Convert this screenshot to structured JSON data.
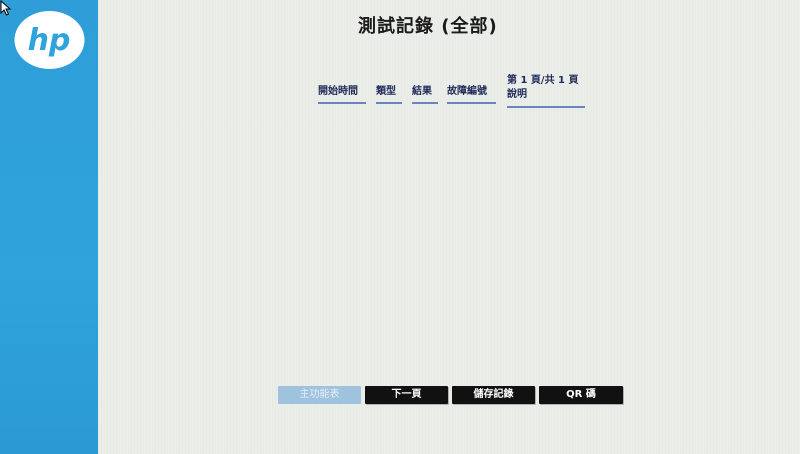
{
  "header": {
    "title": "測試記錄 (全部)"
  },
  "table": {
    "columns": [
      "開始時間",
      "類型",
      "結果",
      "故障編號"
    ],
    "page_info_line1": "第 1 頁/共 1 頁",
    "page_info_line2": "說明"
  },
  "footer": {
    "main_menu_label": "主功能表",
    "next_page_label": "下一頁",
    "save_log_label": "儲存記錄",
    "qr_label": "QR 碼"
  },
  "colors": {
    "sidebar": "#2fa3dc",
    "background": "#ebeee8",
    "button": "#111111",
    "button_disabled": "#9fc2df",
    "underline": "#6c86bd"
  },
  "icons": {
    "logo": "hp-logo",
    "cursor": "mouse-pointer-icon"
  }
}
